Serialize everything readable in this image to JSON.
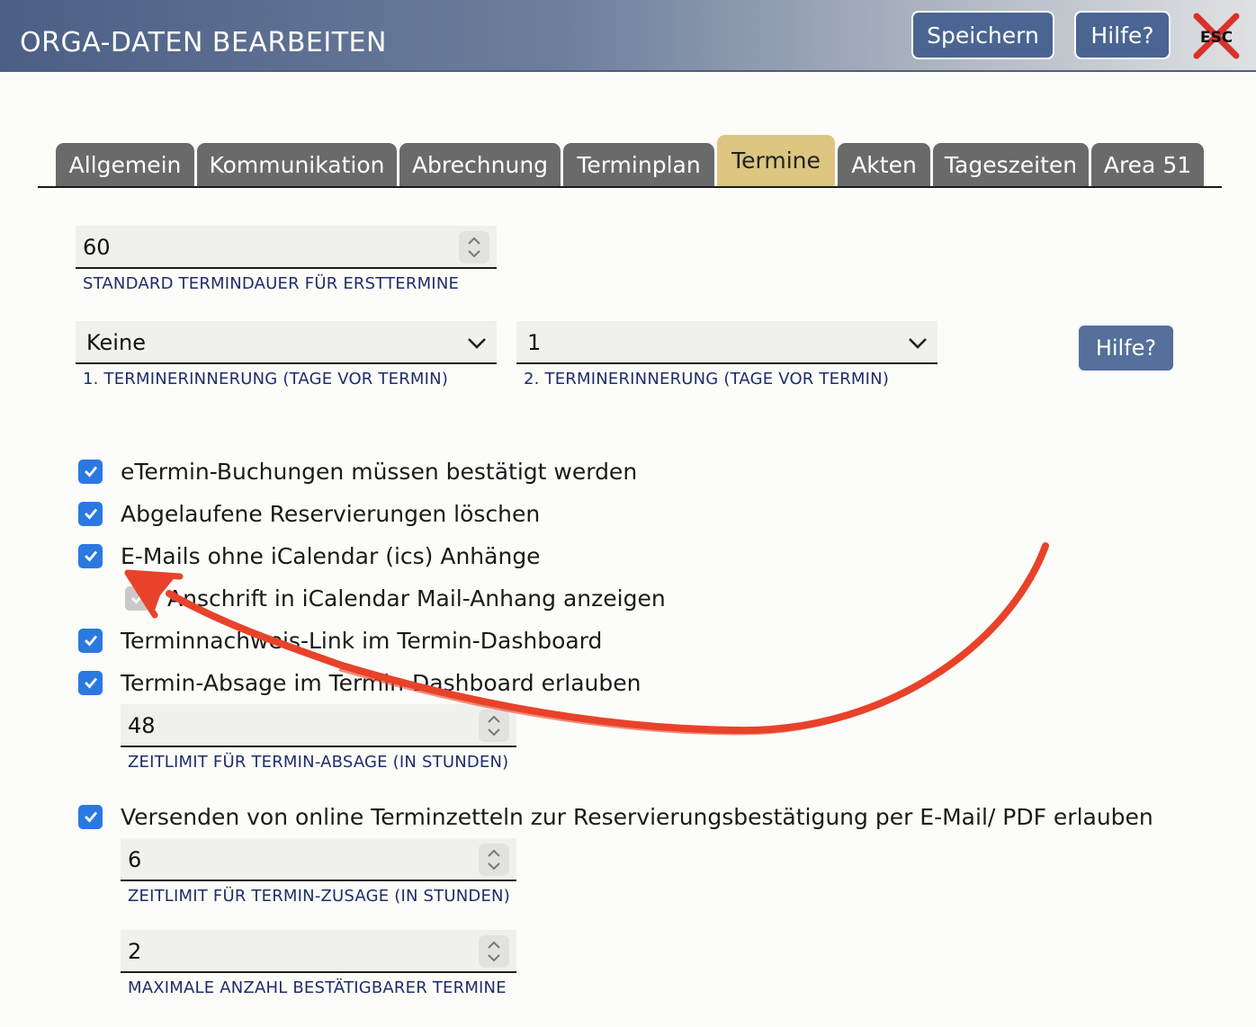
{
  "header": {
    "title": "ORGA-DATEN BEARBEITEN",
    "save_label": "Speichern",
    "help_label": "Hilfe?",
    "esc_label": "ESC"
  },
  "tabs": [
    {
      "label": "Allgemein",
      "active": false
    },
    {
      "label": "Kommunikation",
      "active": false
    },
    {
      "label": "Abrechnung",
      "active": false
    },
    {
      "label": "Terminplan",
      "active": false
    },
    {
      "label": "Termine",
      "active": true
    },
    {
      "label": "Akten",
      "active": false
    },
    {
      "label": "Tageszeiten",
      "active": false
    },
    {
      "label": "Area 51",
      "active": false
    }
  ],
  "form": {
    "standard_duration": {
      "value": "60",
      "label": "STANDARD TERMINDAUER FÜR ERSTTERMINE"
    },
    "reminder1": {
      "value": "Keine",
      "label": "1. TERMINERINNERUNG (TAGE VOR TERMIN)"
    },
    "reminder2": {
      "value": "1",
      "label": "2. TERMINERINNERUNG (TAGE VOR TERMIN)"
    },
    "help_label": "Hilfe?",
    "checkboxes": [
      {
        "label": "eTermin-Buchungen müssen bestätigt werden",
        "checked": true,
        "disabled": false
      },
      {
        "label": "Abgelaufene Reservierungen löschen",
        "checked": true,
        "disabled": false
      },
      {
        "label": "E-Mails ohne iCalendar (ics) Anhänge",
        "checked": true,
        "disabled": false
      },
      {
        "label": "Anschrift in iCalendar Mail-Anhang anzeigen",
        "checked": true,
        "disabled": true
      },
      {
        "label": "Terminnachweis-Link im Termin-Dashboard",
        "checked": true,
        "disabled": false
      },
      {
        "label": "Termin-Absage im Termin-Dashboard erlauben",
        "checked": true,
        "disabled": false
      },
      {
        "label": "Versenden von online Terminzetteln zur Reservierungsbestätigung per E-Mail/ PDF erlauben",
        "checked": true,
        "disabled": false
      }
    ],
    "cancel_limit": {
      "value": "48",
      "label": "ZEITLIMIT FÜR TERMIN-ABSAGE (IN STUNDEN)"
    },
    "confirm_limit": {
      "value": "6",
      "label": "ZEITLIMIT FÜR TERMIN-ZUSAGE (IN STUNDEN)"
    },
    "max_confirmable": {
      "value": "2",
      "label": "MAXIMALE ANZAHL BESTÄTIGBARER TERMINE"
    }
  },
  "colors": {
    "accent": "#2b79e0",
    "tab_active": "#dcc680",
    "tab_inactive": "#6a6a6a",
    "button": "#4a6592",
    "label": "#1f2d6b",
    "annotation_arrow": "#e8432a"
  },
  "icons": {
    "esc": "close-x-icon",
    "spinner": "up-down-chevron-icon",
    "select": "chevron-down-icon",
    "checkbox": "checkmark-icon",
    "annotation": "red-arrow-annotation"
  }
}
